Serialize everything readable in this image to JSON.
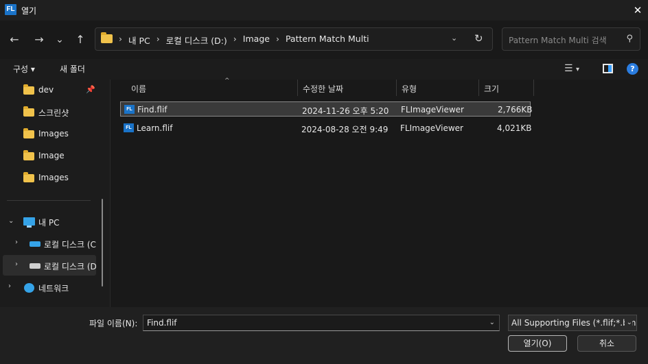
{
  "window": {
    "title": "열기",
    "app_icon_text": "FL"
  },
  "nav": {
    "back": "←",
    "forward": "→",
    "recent": "⌄",
    "up": "↑",
    "breadcrumbs": [
      "내 PC",
      "로컬 디스크 (D:)",
      "Image",
      "Pattern Match Multi"
    ],
    "search_placeholder": "Pattern Match Multi 검색"
  },
  "toolbar": {
    "organize": "구성 ▾",
    "new_folder": "새 폴더"
  },
  "sidebar": {
    "quick": [
      {
        "label": "dev",
        "pinned": true
      },
      {
        "label": "스크린샷"
      },
      {
        "label": "Images"
      },
      {
        "label": "Image"
      },
      {
        "label": "Images"
      }
    ],
    "this_pc": "내 PC",
    "drives": [
      "로컬 디스크 (C",
      "로컬 디스크 (D"
    ],
    "network": "네트워크"
  },
  "columns": {
    "name": "이름",
    "modified": "수정한 날짜",
    "type": "유형",
    "size": "크기"
  },
  "files": [
    {
      "name": "Find.flif",
      "modified": "2024-11-26 오후 5:20",
      "type": "FLImageViewer",
      "size": "2,766KB",
      "selected": true
    },
    {
      "name": "Learn.flif",
      "modified": "2024-08-28 오전 9:49",
      "type": "FLImageViewer",
      "size": "4,021KB",
      "selected": false
    }
  ],
  "bottom": {
    "filename_label": "파일 이름(N):",
    "filename_value": "Find.flif",
    "filetype_value": "All Supporting Files (*.flif;*.bm",
    "open_button": "열기(O)",
    "cancel_button": "취소"
  }
}
